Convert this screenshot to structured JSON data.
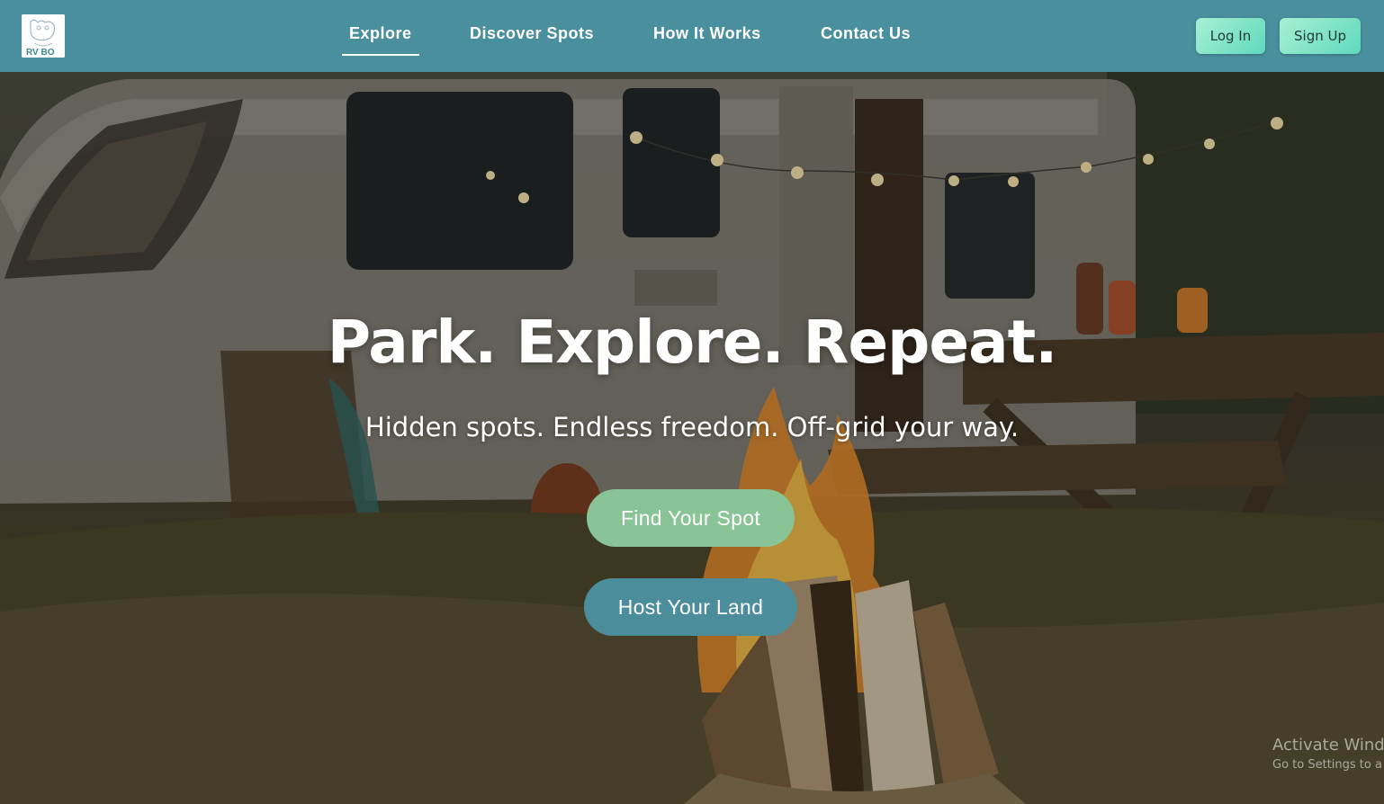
{
  "brand": {
    "logo_icon": "rv-logo-icon",
    "logo_text": "RV BO"
  },
  "nav": {
    "links": [
      {
        "label": "Explore",
        "active": true
      },
      {
        "label": "Discover Spots",
        "active": false
      },
      {
        "label": "How It Works",
        "active": false
      },
      {
        "label": "Contact Us",
        "active": false
      }
    ],
    "login_label": "Log In",
    "signup_label": "Sign Up"
  },
  "hero": {
    "title": "Park. Explore. Repeat.",
    "subtitle": "Hidden spots. Endless freedom. Off-grid your way.",
    "primary_cta": "Find Your Spot",
    "secondary_cta": "Host Your Land"
  },
  "watermark": {
    "title": "Activate Wind",
    "subtitle": "Go to Settings to a"
  },
  "colors": {
    "navbar": "#4a8f9e",
    "auth_button_start": "#a8f0d2",
    "auth_button_end": "#5fd8bd",
    "find_spot_button": "#89c497",
    "host_land_button": "#4b8d9b"
  }
}
